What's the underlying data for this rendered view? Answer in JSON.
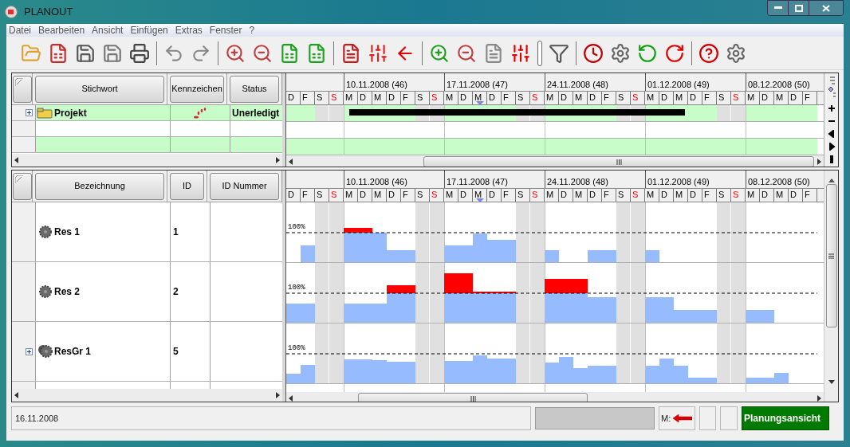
{
  "window": {
    "title": "PLANOUT"
  },
  "menu": [
    "Datei",
    "Bearbeiten",
    "Ansicht",
    "Einfügen",
    "Extras",
    "Fenster",
    "?"
  ],
  "top_table": {
    "columns": [
      "Stichwort",
      "Kennzeichen",
      "Status"
    ],
    "rows": [
      {
        "name": "Projekt",
        "status": "Unerledigt",
        "expanded": false
      }
    ]
  },
  "top_gantt": {
    "weeks": [
      "10.11.2008 (46)",
      "17.11.2008 (47)",
      "24.11.2008 (48)",
      "01.12.2008 (49)",
      "08.12.2008 (50)"
    ],
    "days": [
      {
        "label": "D",
        "kind": "weekday",
        "today": false
      },
      {
        "label": "F",
        "kind": "weekday",
        "today": false
      },
      {
        "label": "S",
        "kind": "saturday",
        "today": false
      },
      {
        "label": "S",
        "kind": "sunday",
        "today": false
      },
      {
        "label": "M",
        "kind": "weekday",
        "today": false
      },
      {
        "label": "D",
        "kind": "weekday",
        "today": false
      },
      {
        "label": "M",
        "kind": "weekday",
        "today": false
      },
      {
        "label": "D",
        "kind": "weekday",
        "today": false
      },
      {
        "label": "F",
        "kind": "weekday",
        "today": false
      },
      {
        "label": "S",
        "kind": "saturday",
        "today": false
      },
      {
        "label": "S",
        "kind": "sunday",
        "today": false
      },
      {
        "label": "M",
        "kind": "weekday",
        "today": false
      },
      {
        "label": "D",
        "kind": "weekday",
        "today": false
      },
      {
        "label": "M",
        "kind": "weekday",
        "today": true
      },
      {
        "label": "D",
        "kind": "weekday",
        "today": false
      },
      {
        "label": "F",
        "kind": "weekday",
        "today": false
      },
      {
        "label": "S",
        "kind": "saturday",
        "today": false
      },
      {
        "label": "S",
        "kind": "sunday",
        "today": false
      },
      {
        "label": "M",
        "kind": "weekday",
        "today": false
      },
      {
        "label": "D",
        "kind": "weekday",
        "today": false
      },
      {
        "label": "M",
        "kind": "weekday",
        "today": false
      },
      {
        "label": "D",
        "kind": "weekday",
        "today": false
      },
      {
        "label": "F",
        "kind": "weekday",
        "today": false
      },
      {
        "label": "S",
        "kind": "saturday",
        "today": false
      },
      {
        "label": "S",
        "kind": "sunday",
        "today": false
      },
      {
        "label": "M",
        "kind": "weekday",
        "today": false
      },
      {
        "label": "D",
        "kind": "weekday",
        "today": false
      },
      {
        "label": "M",
        "kind": "weekday",
        "today": false
      },
      {
        "label": "D",
        "kind": "weekday",
        "today": false
      },
      {
        "label": "F",
        "kind": "weekday",
        "today": false
      },
      {
        "label": "S",
        "kind": "saturday",
        "today": false
      },
      {
        "label": "S",
        "kind": "sunday",
        "today": false
      },
      {
        "label": "M",
        "kind": "weekday",
        "today": false
      },
      {
        "label": "D",
        "kind": "weekday",
        "today": false
      },
      {
        "label": "M",
        "kind": "weekday",
        "today": false
      },
      {
        "label": "D",
        "kind": "weekday",
        "today": false
      },
      {
        "label": "F",
        "kind": "weekday",
        "today": false
      }
    ]
  },
  "bottom_table": {
    "columns": [
      "Bezeichnung",
      "ID",
      "ID Nummer"
    ],
    "rows": [
      {
        "name": "Res 1",
        "id": "1",
        "kind": "resource",
        "load_label": "100%"
      },
      {
        "name": "Res 2",
        "id": "2",
        "kind": "resource",
        "load_label": "100%"
      },
      {
        "name": "ResGr 1",
        "id": "5",
        "kind": "group",
        "expanded": false,
        "load_label": "100%"
      }
    ]
  },
  "bottom_gantt": {
    "weeks": [
      "10.11.2008 (46)",
      "17.11.2008 (47)",
      "24.11.2008 (48)",
      "01.12.2008 (49)",
      "08.12.2008 (50)"
    ],
    "days": [
      {
        "label": "D",
        "kind": "weekday",
        "today": false
      },
      {
        "label": "F",
        "kind": "weekday",
        "today": false
      },
      {
        "label": "S",
        "kind": "saturday",
        "today": false
      },
      {
        "label": "S",
        "kind": "sunday",
        "today": false
      },
      {
        "label": "M",
        "kind": "weekday",
        "today": false
      },
      {
        "label": "D",
        "kind": "weekday",
        "today": false
      },
      {
        "label": "M",
        "kind": "weekday",
        "today": false
      },
      {
        "label": "D",
        "kind": "weekday",
        "today": false
      },
      {
        "label": "F",
        "kind": "weekday",
        "today": false
      },
      {
        "label": "S",
        "kind": "saturday",
        "today": false
      },
      {
        "label": "S",
        "kind": "sunday",
        "today": false
      },
      {
        "label": "M",
        "kind": "weekday",
        "today": false
      },
      {
        "label": "D",
        "kind": "weekday",
        "today": false
      },
      {
        "label": "M",
        "kind": "weekday",
        "today": true
      },
      {
        "label": "D",
        "kind": "weekday",
        "today": false
      },
      {
        "label": "F",
        "kind": "weekday",
        "today": false
      },
      {
        "label": "S",
        "kind": "saturday",
        "today": false
      },
      {
        "label": "S",
        "kind": "sunday",
        "today": false
      },
      {
        "label": "M",
        "kind": "weekday",
        "today": false
      },
      {
        "label": "D",
        "kind": "weekday",
        "today": false
      },
      {
        "label": "M",
        "kind": "weekday",
        "today": false
      },
      {
        "label": "D",
        "kind": "weekday",
        "today": false
      },
      {
        "label": "F",
        "kind": "weekday",
        "today": false
      },
      {
        "label": "S",
        "kind": "saturday",
        "today": false
      },
      {
        "label": "S",
        "kind": "sunday",
        "today": false
      },
      {
        "label": "M",
        "kind": "weekday",
        "today": false
      },
      {
        "label": "D",
        "kind": "weekday",
        "today": false
      },
      {
        "label": "M",
        "kind": "weekday",
        "today": false
      },
      {
        "label": "D",
        "kind": "weekday",
        "today": false
      },
      {
        "label": "F",
        "kind": "weekday",
        "today": false
      },
      {
        "label": "S",
        "kind": "saturday",
        "today": false
      },
      {
        "label": "S",
        "kind": "sunday",
        "today": false
      },
      {
        "label": "M",
        "kind": "weekday",
        "today": false
      },
      {
        "label": "D",
        "kind": "weekday",
        "today": false
      },
      {
        "label": "M",
        "kind": "weekday",
        "today": false
      },
      {
        "label": "D",
        "kind": "weekday",
        "today": false
      },
      {
        "label": "F",
        "kind": "weekday",
        "today": false
      }
    ]
  },
  "status_bar": {
    "date": "16.11.2008",
    "marker_label": "M:",
    "view": "Planungsansicht"
  }
}
